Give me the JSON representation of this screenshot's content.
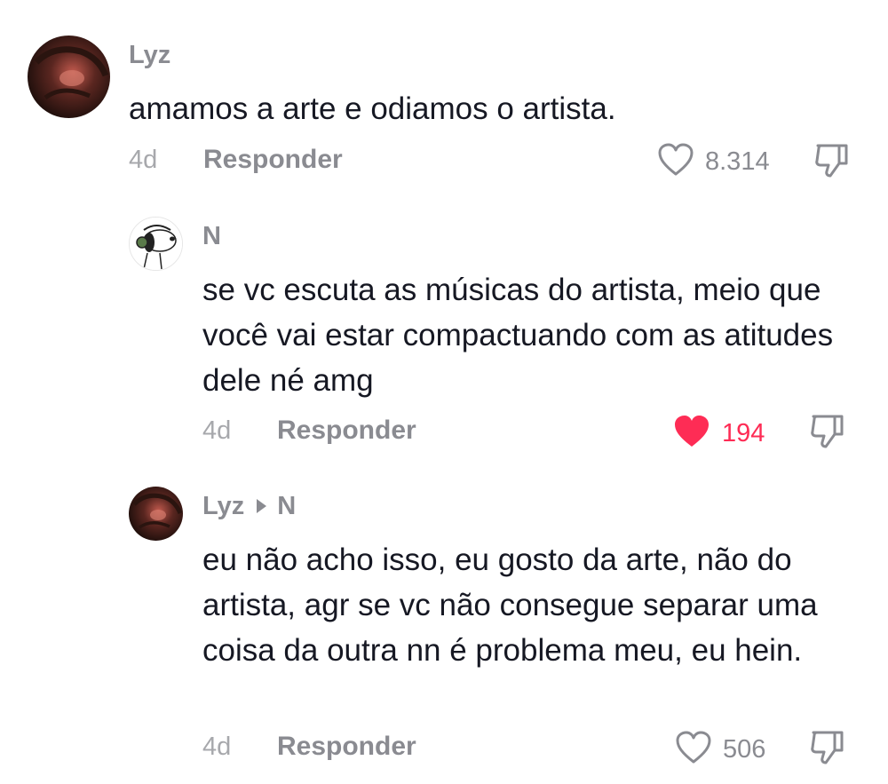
{
  "comments": [
    {
      "username": "Lyz",
      "text": "amamos a arte e odiamos o artista.",
      "time": "4d",
      "reply_label": "Responder",
      "likes": "8.314",
      "liked": false
    },
    {
      "username": "N",
      "text": "se vc escuta as músicas do artista, meio que você vai estar compactuando com as atitudes dele né amg",
      "time": "4d",
      "reply_label": "Responder",
      "likes": "194",
      "liked": true
    },
    {
      "username": "Lyz",
      "reply_to": "N",
      "text": "eu não acho isso, eu gosto da arte, não do artista, agr se vc não consegue separar uma coisa da outra nn é problema meu, eu hein.",
      "time": "4d",
      "reply_label": "Responder",
      "likes": "506",
      "liked": false
    }
  ],
  "icons": {
    "like": "heart-icon",
    "dislike": "thumbs-down-icon",
    "reply_arrow": "triangle-right-icon"
  },
  "colors": {
    "liked": "#fe2c55",
    "muted": "#8a8b91"
  }
}
